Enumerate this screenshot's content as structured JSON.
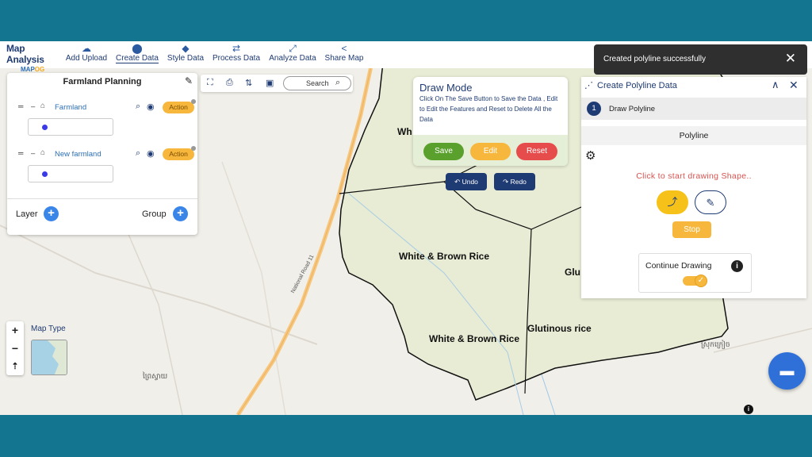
{
  "app": {
    "logo_title": "Map Analysis",
    "logo_sub_a": "MAP",
    "logo_sub_b": "OG"
  },
  "menu": [
    {
      "label": "Add Upload",
      "icon": "cloud-upload-icon"
    },
    {
      "label": "Create Data",
      "icon": "map-pin-icon"
    },
    {
      "label": "Style Data",
      "icon": "paint-bucket-icon"
    },
    {
      "label": "Process Data",
      "icon": "process-icon"
    },
    {
      "label": "Analyze Data",
      "icon": "analyze-icon"
    },
    {
      "label": "Share Map",
      "icon": "share-icon"
    }
  ],
  "left_panel": {
    "title": "Farmland Planning",
    "layers": [
      {
        "name": "Farmland",
        "action": "Action",
        "color": "#3a3ae8"
      },
      {
        "name": "New farmland",
        "action": "Action",
        "color": "#3a3ae8"
      }
    ],
    "layer_label": "Layer",
    "group_label": "Group"
  },
  "search": {
    "label": "Search"
  },
  "draw_mode": {
    "title": "Draw Mode",
    "description": "Click On The Save Button to Save the Data , Edit to Edit the Features and Reset to Delete All the Data",
    "save": "Save",
    "edit": "Edit",
    "reset": "Reset",
    "undo": "Undo",
    "redo": "Redo"
  },
  "toast": {
    "message": "Created polyline successfully",
    "close": "✕"
  },
  "right_panel": {
    "title": "Create Polyline Data",
    "step_number": "1",
    "step_label": "Draw Polyline",
    "tab": "Polyline",
    "instruction": "Click to start drawing Shape..",
    "stop": "Stop",
    "continue_label": "Continue Drawing",
    "continue_enabled": true
  },
  "map": {
    "labels": {
      "wh": "Wh",
      "white_brown_1": "White & Brown Rice",
      "white_brown_2": "White & Brown Rice",
      "glu_partial": "Glu",
      "glutinous": "Glutinous rice",
      "national_road": "National Road 11",
      "khmer_1": "ស្រុកក្រៀច",
      "khmer_2": "ព្រៃស្វាយ"
    },
    "map_type_label": "Map Type",
    "zoom_in": "+",
    "zoom_out": "−"
  },
  "colors": {
    "navy": "#1f3b73",
    "accent_yellow": "#f6b73c",
    "save_green": "#5aa02c",
    "reset_red": "#e74c4c",
    "frame_teal": "#13758f",
    "farm_fill": "#e8ecd4"
  }
}
